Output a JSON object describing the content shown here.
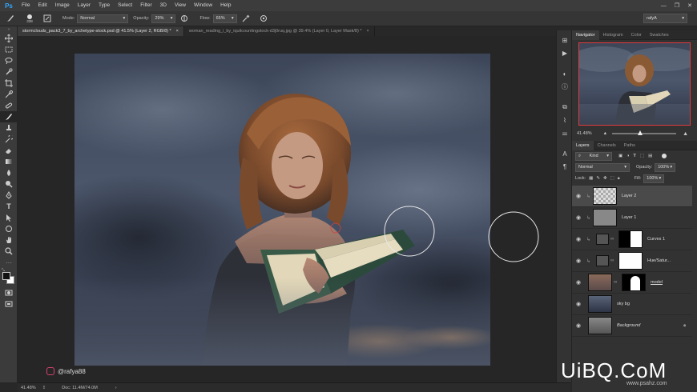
{
  "app": {
    "logo": "Ps"
  },
  "menu": [
    "File",
    "Edit",
    "Image",
    "Layer",
    "Type",
    "Select",
    "Filter",
    "3D",
    "View",
    "Window",
    "Help"
  ],
  "window_controls": [
    "—",
    "❐",
    "✕"
  ],
  "options": {
    "brush_size": "338",
    "mode_label": "Mode:",
    "mode_value": "Normal",
    "opacity_label": "Opacity:",
    "opacity_value": "29%",
    "flow_label": "Flow:",
    "flow_value": "65%",
    "workspace": "rafyA"
  },
  "tabs": [
    {
      "title": "stormclouds_pack3_7_by_archetype-stock.psd @ 41.5% (Layer 2, RGB/8) *",
      "close": "×",
      "active": true
    },
    {
      "title": "woman_reading_i_by_iquitcountingstock-d3j0ruq.jpg @ 39.4% (Layer 0, Layer Mask/8) *",
      "close": "×",
      "active": false
    }
  ],
  "status": {
    "zoom": "41.48%",
    "doc": "Doc: 11.4M/74.0M",
    "arrow": "›"
  },
  "canvas_overlay": {
    "credit": "@rafya88"
  },
  "navigator": {
    "tabs": [
      "Navigator",
      "Histogram",
      "Color",
      "Swatches"
    ],
    "zoom": "41.48%"
  },
  "layers": {
    "tabs": [
      "Layers",
      "Channels",
      "Paths"
    ],
    "filter_label": "Kind",
    "blend_mode": "Normal",
    "opacity_label": "Opacity:",
    "opacity_value": "100%",
    "lock_label": "Lock:",
    "fill_label": "Fill:",
    "fill_value": "100%",
    "items": [
      {
        "name": "Layer 2",
        "selected": true
      },
      {
        "name": "Layer 1",
        "selected": false
      },
      {
        "name": "Curves 1",
        "selected": false
      },
      {
        "name": "Hue/Satur...",
        "selected": false
      },
      {
        "name": "model",
        "selected": false
      },
      {
        "name": "sky bg",
        "selected": false
      },
      {
        "name": "Background",
        "selected": false
      }
    ]
  },
  "watermark": {
    "text": "UiBQ.CoM",
    "subtext": "www.psahz.com"
  },
  "colors": {
    "accent_blue": "#31a8ff",
    "nav_frame": "#e0393e",
    "sky_dark": "#2c3445",
    "sky_mid": "#4a5570"
  }
}
